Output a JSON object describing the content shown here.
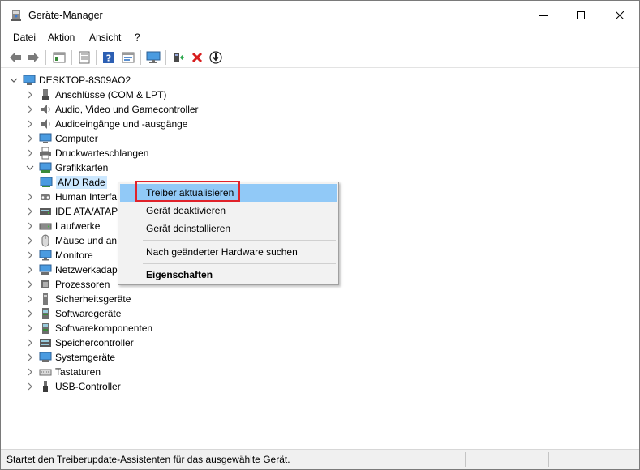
{
  "window": {
    "title": "Geräte-Manager"
  },
  "menu": [
    "Datei",
    "Aktion",
    "Ansicht",
    "?"
  ],
  "toolbar_icons": [
    "back-arrow-icon",
    "forward-arrow-icon",
    "properties-list-icon",
    "device-list-icon",
    "help-icon",
    "details-icon",
    "monitor-icon",
    "add-driver-icon",
    "remove-device-icon",
    "download-driver-icon"
  ],
  "tree": {
    "root": "DESKTOP-8S09AO2",
    "categories": [
      {
        "label": "Anschlüsse (COM & LPT)",
        "icon": "port-icon"
      },
      {
        "label": "Audio, Video und Gamecontroller",
        "icon": "speaker-icon"
      },
      {
        "label": "Audioeingänge und -ausgänge",
        "icon": "speaker-icon"
      },
      {
        "label": "Computer",
        "icon": "computer-icon"
      },
      {
        "label": "Druckwarteschlangen",
        "icon": "printer-icon"
      },
      {
        "label": "Grafikkarten",
        "icon": "display-adapter-icon"
      },
      {
        "label": "Human Interfa",
        "icon": "hid-icon"
      },
      {
        "label": "IDE ATA/ATAPI",
        "icon": "ide-icon"
      },
      {
        "label": "Laufwerke",
        "icon": "drive-icon"
      },
      {
        "label": "Mäuse und an",
        "icon": "mouse-icon"
      },
      {
        "label": "Monitore",
        "icon": "monitor-icon"
      },
      {
        "label": "Netzwerkadap",
        "icon": "network-icon"
      },
      {
        "label": "Prozessoren",
        "icon": "processor-icon"
      },
      {
        "label": "Sicherheitsgeräte",
        "icon": "security-icon"
      },
      {
        "label": "Softwaregeräte",
        "icon": "software-device-icon"
      },
      {
        "label": "Softwarekomponenten",
        "icon": "software-component-icon"
      },
      {
        "label": "Speichercontroller",
        "icon": "storage-icon"
      },
      {
        "label": "Systemgeräte",
        "icon": "system-icon"
      },
      {
        "label": "Tastaturen",
        "icon": "keyboard-icon"
      },
      {
        "label": "USB-Controller",
        "icon": "usb-icon"
      }
    ],
    "child_device": "AMD Rade"
  },
  "context_menu": {
    "items": [
      "Treiber aktualisieren",
      "Gerät deaktivieren",
      "Gerät deinstallieren",
      "Nach geänderter Hardware suchen",
      "Eigenschaften"
    ]
  },
  "status": {
    "text": "Startet den Treiberupdate-Assistenten für das ausgewählte Gerät."
  },
  "colors": {
    "highlight": "#91c9f7",
    "selection": "#cce8ff",
    "annotation": "#e0222a"
  }
}
